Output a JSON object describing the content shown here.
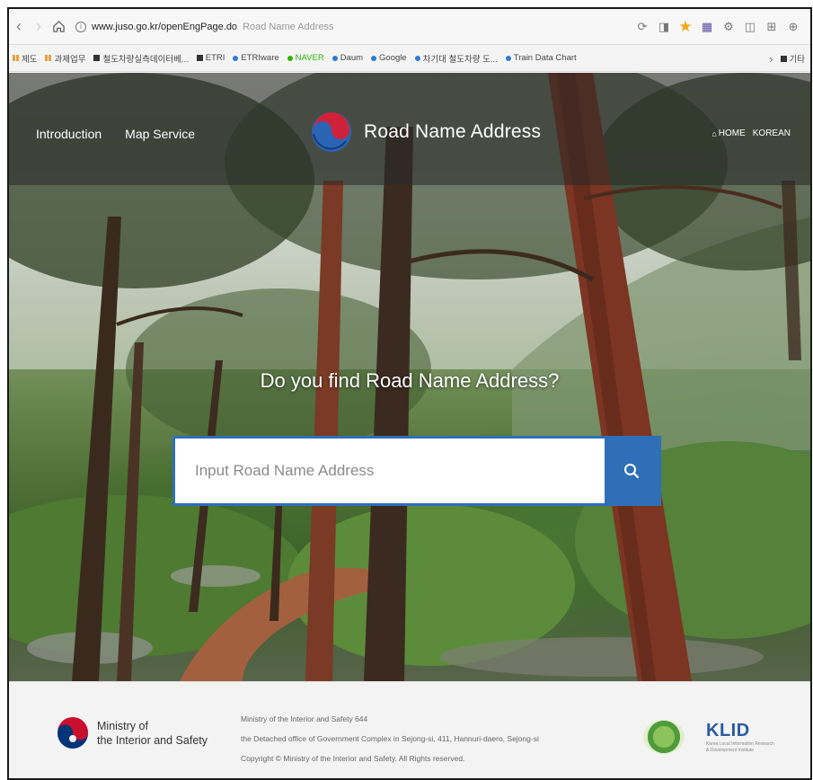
{
  "browser": {
    "url_host": "www.juso.go.kr/openEngPage.do",
    "tab_title": "Road Name Address",
    "bookmarks": [
      "제도",
      "과제업무",
      "철도차량실측데이터베...",
      "ETRI",
      "ETRIware",
      "NAVER",
      "Daum",
      "Google",
      "차기대 철도차량 도...",
      "Train Data Chart"
    ],
    "bookmark_overflow": "기타"
  },
  "header": {
    "menu_left": [
      "Introduction",
      "Map Service"
    ],
    "brand": "Road Name Address",
    "home_label": "HOME",
    "lang_label": "KOREAN"
  },
  "hero": {
    "question": "Do you find Road Name Address?",
    "search_placeholder": "Input Road Name Address"
  },
  "footer": {
    "ministry_line1": "Ministry of",
    "ministry_line2": "the Interior and Safety",
    "info": [
      "Ministry of the Interior and Safety 644",
      "the Detached office of Government Complex in Sejong-si, 411, Hannuri-daero, Sejong-si",
      "Copyright © Ministry of the Interior and Safety. All Rights reserved."
    ],
    "klid_name": "KLID",
    "klid_sub": "Korea Local Information Research & Development Institute"
  },
  "colors": {
    "accent": "#2f6fb8",
    "gov_red": "#c8102e",
    "gov_blue": "#003478"
  }
}
